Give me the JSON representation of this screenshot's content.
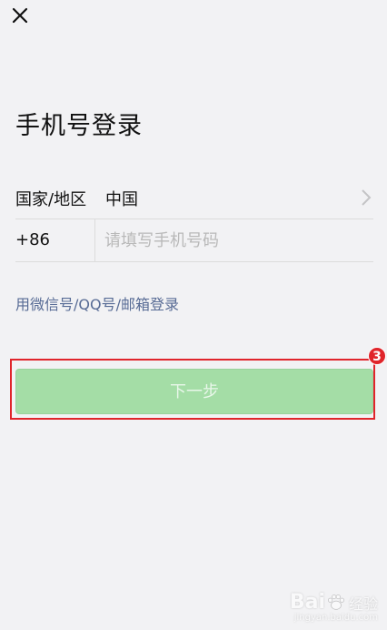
{
  "header": {
    "close_icon": "close-icon"
  },
  "page": {
    "title": "手机号登录"
  },
  "region": {
    "label": "国家/地区",
    "value": "中国",
    "chevron_icon": "chevron-right-icon"
  },
  "phone": {
    "country_code": "+86",
    "value": "",
    "placeholder": "请填写手机号码"
  },
  "alt_login": {
    "label": "用微信号/QQ号/邮箱登录"
  },
  "next_button": {
    "label": "下一步",
    "enabled": false,
    "color": "#a4dda6"
  },
  "annotation": {
    "step_number": "3",
    "color": "#e0252b"
  },
  "watermark": {
    "brand_left": "Bai",
    "brand_right": "经验",
    "url": "jingyan.baidu.com"
  }
}
